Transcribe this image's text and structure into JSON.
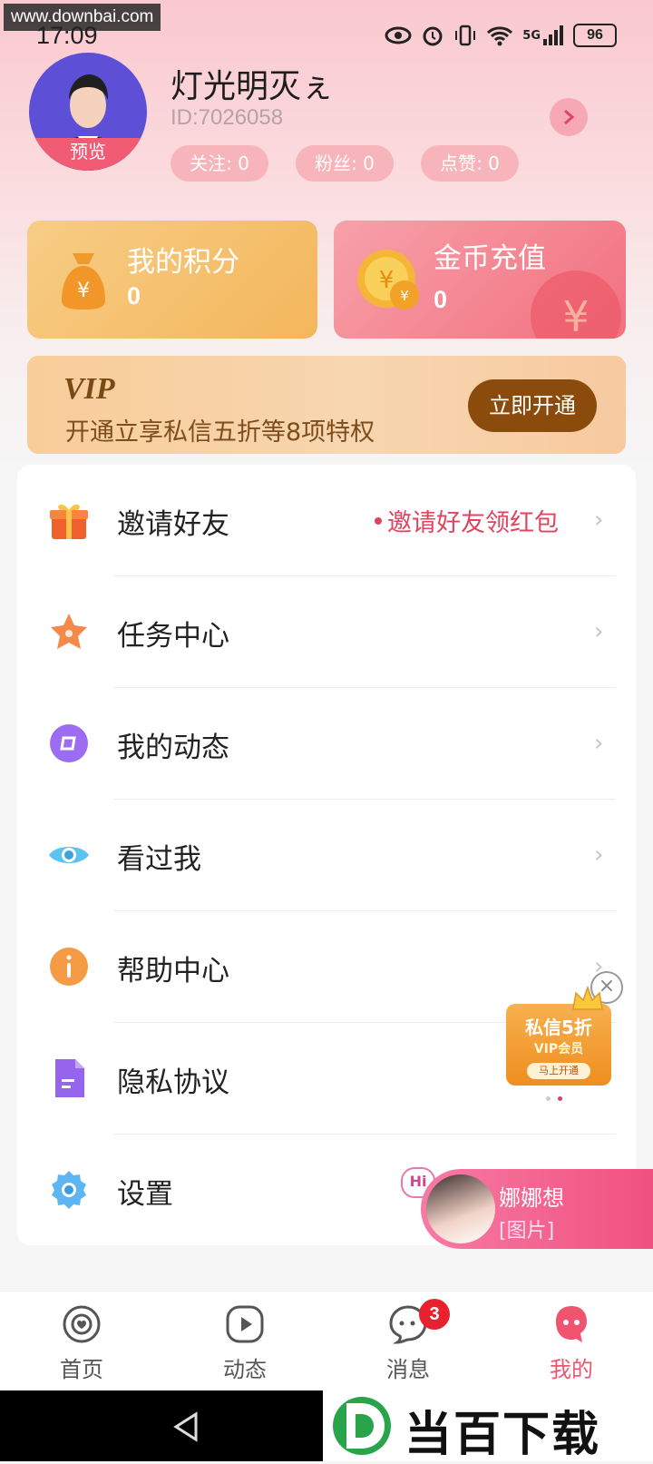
{
  "watermark": "www.downbai.com",
  "status": {
    "time": "17:09",
    "battery": "96",
    "network": "5G"
  },
  "profile": {
    "name": "灯光明灭ぇ",
    "id": "ID:7026058",
    "avatar_tag": "预览",
    "stats": [
      {
        "label": "关注: 0"
      },
      {
        "label": "粉丝: 0"
      },
      {
        "label": "点赞: 0"
      }
    ]
  },
  "cards": {
    "points": {
      "title": "我的积分",
      "value": "0"
    },
    "coins": {
      "title": "金币充值",
      "value": "0"
    }
  },
  "vip": {
    "logo": "VIP",
    "desc": "开通立享私信五折等8项特权",
    "button": "立即开通"
  },
  "menu": [
    {
      "label": "邀请好友",
      "hint": "邀请好友领红包",
      "icon": "gift-icon"
    },
    {
      "label": "任务中心",
      "icon": "star-icon"
    },
    {
      "label": "我的动态",
      "icon": "moments-icon"
    },
    {
      "label": "看过我",
      "icon": "eye-icon"
    },
    {
      "label": "帮助中心",
      "icon": "info-icon"
    },
    {
      "label": "隐私协议",
      "icon": "document-icon"
    },
    {
      "label": "设置",
      "icon": "gear-icon"
    }
  ],
  "float_ad": {
    "line1": "私信5折",
    "line2": "VIP会员",
    "line3": "马上开通"
  },
  "chat": {
    "hi": "Hi",
    "name": "娜娜想",
    "message": "[图片]"
  },
  "tabs": [
    {
      "label": "首页",
      "icon": "home-icon"
    },
    {
      "label": "动态",
      "icon": "play-icon"
    },
    {
      "label": "消息",
      "icon": "message-icon",
      "badge": "3"
    },
    {
      "label": "我的",
      "icon": "profile-icon"
    }
  ],
  "brand": {
    "text": "当百下载",
    "letter": "D"
  },
  "colors": {
    "accent": "#f15b73",
    "vip_brown": "#8a4b0d",
    "active_tab": "#f0546e",
    "hint": "#e0445e"
  }
}
